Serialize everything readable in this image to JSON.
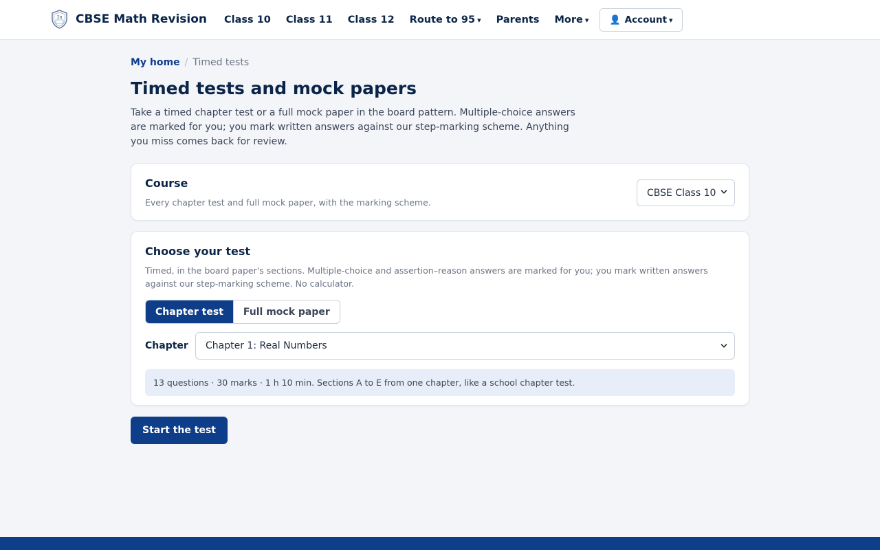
{
  "header": {
    "brand_name": "CBSE Math Revision",
    "nav": [
      {
        "label": "Class 10"
      },
      {
        "label": "Class 11"
      },
      {
        "label": "Class 12"
      },
      {
        "label": "Route to 95",
        "caret": "▾"
      },
      {
        "label": "Parents"
      },
      {
        "label": "More",
        "caret": "▾"
      }
    ],
    "account": {
      "icon": "person-icon",
      "label": "Account",
      "caret": "▾"
    }
  },
  "breadcrumb": {
    "home": "My home",
    "separator": "/",
    "current": "Timed tests"
  },
  "page": {
    "title": "Timed tests and mock papers",
    "intro": "Take a timed chapter test or a full mock paper in the board pattern. Multiple-choice answers are marked for you; you mark written answers against our step-marking scheme. Anything you miss comes back for review."
  },
  "course_card": {
    "title": "Course",
    "subtitle": "Every chapter test and full mock paper, with the marking scheme.",
    "selected": "CBSE Class 10"
  },
  "test_card": {
    "title": "Choose your test",
    "subtitle": "Timed, in the board paper's sections. Multiple-choice and assertion–reason answers are marked for you; you mark written answers against our step-marking scheme. No calculator.",
    "modes": [
      {
        "label": "Chapter test",
        "active": true
      },
      {
        "label": "Full mock paper",
        "active": false
      }
    ],
    "chapter_label": "Chapter",
    "chapter_selected": "Chapter 1: Real Numbers",
    "info": "13 questions · 30 marks · 1 h 10 min. Sections A to E from one chapter, like a school chapter test."
  },
  "actions": {
    "start_label": "Start the test"
  },
  "colors": {
    "primary": "#0e3d8a",
    "text_dark": "#0b2548",
    "background": "#f3f5f9",
    "info_bg": "#e8eef9"
  }
}
